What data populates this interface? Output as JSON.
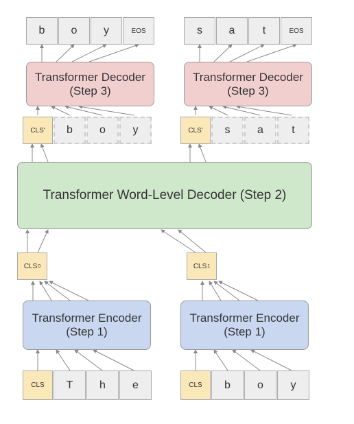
{
  "output_tokens_left": [
    "b",
    "o",
    "y",
    "EOS"
  ],
  "output_tokens_right": [
    "s",
    "a",
    "t",
    "EOS"
  ],
  "decoder3_label": "Transformer Decoder (Step 3)",
  "cls_prime": "CLS'",
  "dec_input_left": [
    "b",
    "o",
    "y"
  ],
  "dec_input_right": [
    "s",
    "a",
    "t"
  ],
  "wordlevel_label": "Transformer Word-Level Decoder (Step 2)",
  "cls_sub_left": "CLS",
  "cls_sub_right": "CLS",
  "cls_sub_left_suffix": "0",
  "cls_sub_right_suffix": "1",
  "encoder_label": "Transformer Encoder (Step 1)",
  "input_cls": "CLS",
  "input_tokens_left": [
    "T",
    "h",
    "e"
  ],
  "input_tokens_right": [
    "b",
    "o",
    "y"
  ],
  "colors": {
    "encoder": "#c9d8f0",
    "wordlevel": "#cfe8cc",
    "decoder": "#f2cfcf",
    "cls": "#fbe8b9",
    "token": "#eeeeee"
  }
}
